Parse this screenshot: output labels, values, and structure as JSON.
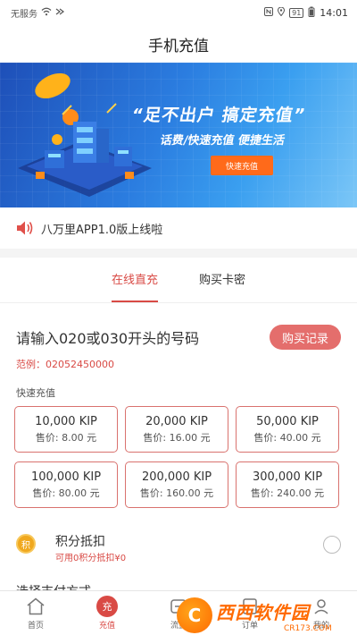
{
  "status_bar": {
    "carrier": "无服务",
    "battery": "91",
    "time": "14:01"
  },
  "header": {
    "title": "手机充值"
  },
  "banner": {
    "slogan": "“足不出户 搞定充值”",
    "subtitle": "话费/快速充值 便捷生活",
    "cta": "快速充值"
  },
  "notice": {
    "text": "八万里APP1.0版上线啦"
  },
  "tabs": [
    {
      "label": "在线直充",
      "active": true
    },
    {
      "label": "购买卡密",
      "active": false
    }
  ],
  "form": {
    "prompt": "请输入020或030开头的号码",
    "record_button": "购买记录",
    "example": "范例：02052450000",
    "quick_label": "快速充值",
    "packages": [
      {
        "amount": "10,000 KIP",
        "price": "售价: 8.00 元"
      },
      {
        "amount": "20,000 KIP",
        "price": "售价: 16.00 元"
      },
      {
        "amount": "50,000 KIP",
        "price": "售价: 40.00 元"
      },
      {
        "amount": "100,000 KIP",
        "price": "售价: 80.00 元"
      },
      {
        "amount": "200,000 KIP",
        "price": "售价: 160.00 元"
      },
      {
        "amount": "300,000 KIP",
        "price": "售价: 240.00 元"
      }
    ],
    "points": {
      "coin": "积",
      "title": "积分抵扣",
      "subtitle": "可用0积分抵扣¥0"
    },
    "pay_method": "选择支付方式"
  },
  "tabbar": {
    "items": [
      {
        "label": "首页"
      },
      {
        "label": "充值",
        "badge": "充"
      },
      {
        "label": "流量"
      },
      {
        "label": "订单"
      },
      {
        "label": "我的"
      }
    ]
  },
  "watermark": {
    "logo": "C",
    "name": "西西软件园",
    "site": "CR173.COM"
  },
  "colors": {
    "accent": "#d94a45",
    "record_button": "#e46e6c",
    "coin": "#f0a81e",
    "banner_blue": "#2b7de0",
    "watermark_orange": "#ff6a00"
  }
}
